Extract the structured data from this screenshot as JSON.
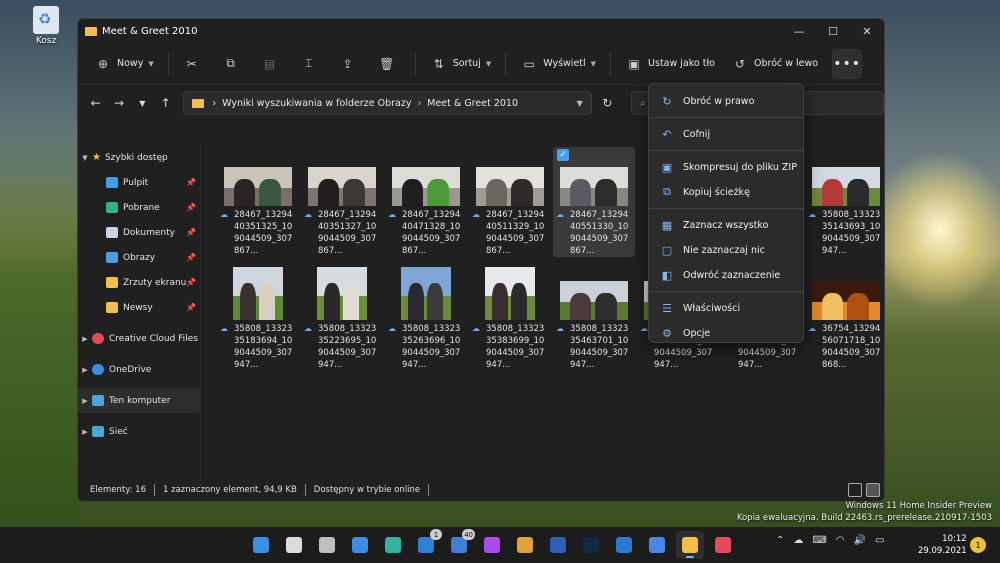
{
  "desktop": {
    "recycle_bin_label": "Kosz"
  },
  "window": {
    "title": "Meet & Greet 2010",
    "controls": {
      "minimize": "—",
      "maximize": "☐",
      "close": "✕"
    }
  },
  "toolbar": {
    "new_label": "Nowy",
    "sort_label": "Sortuj",
    "view_label": "Wyświetl",
    "set_bg_label": "Ustaw jako tło",
    "rotate_left_label": "Obróć w lewo",
    "more_label": "•••"
  },
  "address": {
    "segments": [
      "Wyniki wyszukiwania w folderze Obrazy",
      "Meet & Greet 2010"
    ],
    "separator": "›"
  },
  "sidebar": {
    "quick_access": "Szybki dostęp",
    "items": [
      {
        "label": "Pulpit",
        "color": "#3aa0e8"
      },
      {
        "label": "Pobrane",
        "color": "#2fb38a"
      },
      {
        "label": "Dokumenty",
        "color": "#c9d3dd"
      },
      {
        "label": "Obrazy",
        "color": "#4f9de0"
      },
      {
        "label": "Zrzuty ekranu",
        "color": "#f2c04a"
      },
      {
        "label": "Newsy",
        "color": "#f2c04a"
      }
    ],
    "creative_cloud": "Creative Cloud Files",
    "onedrive": "OneDrive",
    "this_pc": "Ten komputer",
    "network": "Sieć"
  },
  "files": [
    {
      "name": "28467_1329440351325_109044509_307867...",
      "orient": "land",
      "sky": "#c9c3b8",
      "ground": "#7a6f68",
      "p1": "#2a2424",
      "p2": "#3a5540"
    },
    {
      "name": "28467_1329440351327_109044509_307867...",
      "orient": "land",
      "sky": "#d9d4cc",
      "ground": "#7c7570",
      "p1": "#221f1e",
      "p2": "#3b3734"
    },
    {
      "name": "28467_1329440471328_109044509_307867...",
      "orient": "land",
      "sky": "#dedcd6",
      "ground": "#9b9890",
      "p1": "#1f1f22",
      "p2": "#4d9a3a"
    },
    {
      "name": "28467_1329440511329_109044509_307867...",
      "orient": "land",
      "sky": "#e2e1dc",
      "ground": "#9e9c95",
      "p1": "#6b6660",
      "p2": "#2e2a2a"
    },
    {
      "name": "28467_1329440551330_109044509_307867...",
      "orient": "land",
      "sky": "#dcdcd8",
      "ground": "#8a8680",
      "p1": "#5a5a62",
      "p2": "#2d2b2b",
      "selected": true
    },
    {
      "name": "",
      "orient": "land",
      "sky": "#bfcbd6",
      "ground": "#6c7a3a",
      "p1": "#3a3636",
      "p2": "#4a6a3a",
      "hidden": true
    },
    {
      "name": "",
      "orient": "land",
      "sky": "#bfcbd6",
      "ground": "#6c7a3a",
      "p1": "#3a3636",
      "p2": "#4a6a3a",
      "hidden": true
    },
    {
      "name": "35808_1332335143693_109044509_307947...",
      "orient": "land",
      "sky": "#d4dae2",
      "ground": "#6c8a3c",
      "p1": "#b33a3a",
      "p2": "#2b2b2b"
    },
    {
      "name": "35808_1332335183694_109044509_307947...",
      "orient": "port",
      "sky": "#cfd7de",
      "ground": "#5d8a34",
      "p1": "#3a3030",
      "p2": "#d9d0c0"
    },
    {
      "name": "35808_1332335223695_109044509_307947...",
      "orient": "port",
      "sky": "#d6dde2",
      "ground": "#6b8f3a",
      "p1": "#2a2828",
      "p2": "#e2dcd2"
    },
    {
      "name": "35808_1332335263696_109044509_307947...",
      "orient": "port",
      "sky": "#7fa6d6",
      "ground": "#6b8a3a",
      "p1": "#2a2a30",
      "p2": "#3c3c3c"
    },
    {
      "name": "35808_1332335383699_109044509_307947...",
      "orient": "port",
      "sky": "#e6e9ec",
      "ground": "#6c8c3a",
      "p1": "#3a2e2e",
      "p2": "#2b2b2b"
    },
    {
      "name": "35808_1332335463701_109044509_307947...",
      "orient": "land",
      "sky": "#cbd1d6",
      "ground": "#5a7a34",
      "p1": "#4a3a3a",
      "p2": "#2e2e2e"
    },
    {
      "name": "35808_1332335503702_109044509_307947...",
      "orient": "land",
      "sky": "#cfd6dc",
      "ground": "#5f8032",
      "p1": "#3a3a3a",
      "p2": "#575757"
    },
    {
      "name": "35808_1332335623705_109044509_307947...",
      "orient": "land",
      "sky": "#c9d0d6",
      "ground": "#5c7b33",
      "p1": "#333",
      "p2": "#5a5a5a"
    },
    {
      "name": "36754_1329456071718_109044509_307868...",
      "orient": "land",
      "sky": "#3a1a0a",
      "ground": "#e08a2a",
      "p1": "#f0c060",
      "p2": "#b05010"
    }
  ],
  "context_menu": [
    {
      "label": "Obróć w prawo",
      "icon": "rotate-right-icon",
      "glyph": "↻"
    },
    {
      "sep": true
    },
    {
      "label": "Cofnij",
      "icon": "undo-icon",
      "glyph": "↶"
    },
    {
      "sep": true
    },
    {
      "label": "Skompresuj do pliku ZIP",
      "icon": "zip-icon",
      "glyph": "▣"
    },
    {
      "label": "Kopiuj ścieżkę",
      "icon": "copy-path-icon",
      "glyph": "⧉"
    },
    {
      "sep": true
    },
    {
      "label": "Zaznacz wszystko",
      "icon": "select-all-icon",
      "glyph": "▦"
    },
    {
      "label": "Nie zaznaczaj nic",
      "icon": "select-none-icon",
      "glyph": "▢"
    },
    {
      "label": "Odwróć zaznaczenie",
      "icon": "invert-selection-icon",
      "glyph": "◧"
    },
    {
      "sep": true
    },
    {
      "label": "Właściwości",
      "icon": "properties-icon",
      "glyph": "☰"
    },
    {
      "label": "Opcje",
      "icon": "options-icon",
      "glyph": "⚙"
    }
  ],
  "status": {
    "count": "Elementy: 16",
    "selection": "1 zaznaczony element, 94,9 KB",
    "availability": "Dostępny w trybie online"
  },
  "watermark": {
    "line1": "Windows 11 Home Insider Preview",
    "line2": "Kopia ewaluacyjna. Build 22463.rs_prerelease.210917-1503"
  },
  "taskbar": {
    "apps": [
      {
        "name": "start-button",
        "color": "#3a8ee6"
      },
      {
        "name": "search-button",
        "color": "#dcdcdc"
      },
      {
        "name": "task-view-button",
        "color": "#bfbfbf"
      },
      {
        "name": "widgets-button",
        "color": "#3a8ee6"
      },
      {
        "name": "edge-app",
        "color": "#2fb3a3"
      },
      {
        "name": "mail-app",
        "color": "#2f7fd8",
        "badge": "1"
      },
      {
        "name": "todo-app",
        "color": "#3f7fd8",
        "badge": "40"
      },
      {
        "name": "messenger-app",
        "color": "#a84bf0"
      },
      {
        "name": "slack-app",
        "color": "#e0a33a"
      },
      {
        "name": "word-app",
        "color": "#2b5fb8"
      },
      {
        "name": "photoshop-app",
        "color": "#0e2a4a"
      },
      {
        "name": "trello-app",
        "color": "#2b78d0"
      },
      {
        "name": "translate-app",
        "color": "#4a86e8"
      },
      {
        "name": "explorer-app",
        "color": "#f2c04a",
        "active": true
      },
      {
        "name": "creative-cloud-app",
        "color": "#e34a5a"
      }
    ],
    "time": "10:12",
    "date": "29.09.2021",
    "notifications": "1"
  }
}
